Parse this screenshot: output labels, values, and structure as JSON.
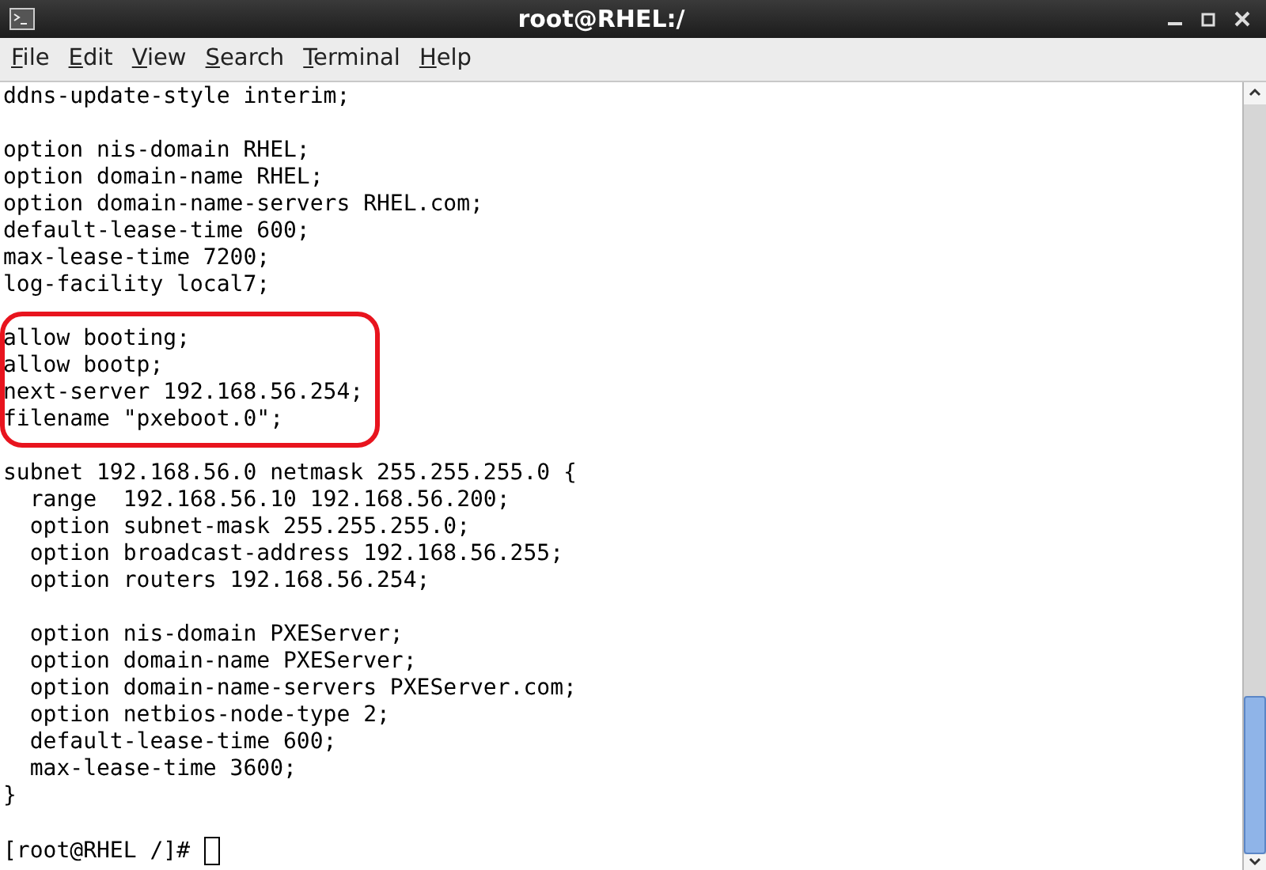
{
  "window": {
    "title": "root@RHEL:/"
  },
  "menu": [
    {
      "label": "File"
    },
    {
      "label": "Edit"
    },
    {
      "label": "View"
    },
    {
      "label": "Search"
    },
    {
      "label": "Terminal"
    },
    {
      "label": "Help"
    }
  ],
  "blocks": [
    {
      "highlighted": false,
      "lines": [
        "ddns-update-style interim;"
      ]
    },
    {
      "highlighted": false,
      "lines": [
        "option nis-domain RHEL;",
        "option domain-name RHEL;",
        "option domain-name-servers RHEL.com;",
        "default-lease-time 600;",
        "max-lease-time 7200;",
        "log-facility local7;"
      ]
    },
    {
      "highlighted": true,
      "lines": [
        "allow booting;",
        "allow bootp;",
        "next-server 192.168.56.254;",
        "filename \"pxeboot.0\";"
      ]
    },
    {
      "highlighted": false,
      "lines": [
        "subnet 192.168.56.0 netmask 255.255.255.0 {",
        "  range  192.168.56.10 192.168.56.200;",
        "  option subnet-mask 255.255.255.0;",
        "  option broadcast-address 192.168.56.255;",
        "  option routers 192.168.56.254;"
      ]
    },
    {
      "highlighted": false,
      "lines": [
        "  option nis-domain PXEServer;",
        "  option domain-name PXEServer;",
        "  option domain-name-servers PXEServer.com;",
        "  option netbios-node-type 2;",
        "  default-lease-time 600;",
        "  max-lease-time 3600;",
        "}"
      ]
    }
  ],
  "prompt": "[root@RHEL /]#"
}
